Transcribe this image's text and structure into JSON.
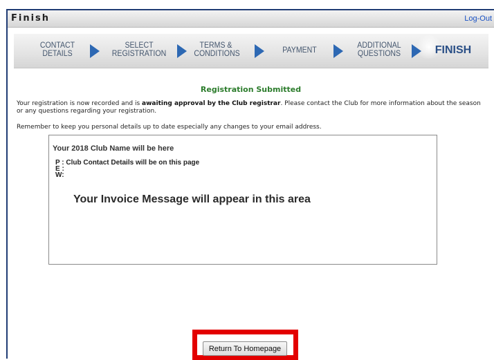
{
  "window": {
    "title": "Finish",
    "logout_label": "Log-Out"
  },
  "steps": [
    {
      "line1": "CONTACT",
      "line2": "DETAILS"
    },
    {
      "line1": "SELECT",
      "line2": "REGISTRATION"
    },
    {
      "line1": "TERMS &",
      "line2": "CONDITIONS"
    },
    {
      "line1": "PAYMENT",
      "line2": ""
    },
    {
      "line1": "ADDITIONAL",
      "line2": "QUESTIONS"
    },
    {
      "line1": "FINISH",
      "line2": ""
    }
  ],
  "active_step": "FINISH",
  "content": {
    "heading": "Registration Submitted",
    "para1_before": "Your registration is now recorded and is ",
    "para1_bold": "awaiting approval by the Club registrar",
    "para1_after": ". Please contact the Club for more information about the season or any questions regarding your registration.",
    "para2": "Remember to keep you personal details up to date especially any changes to your email address."
  },
  "invoice": {
    "club_name": "Your 2018 Club Name will be here",
    "phone_line": "P :  Club Contact Details will be on this page",
    "email_line": "E :",
    "web_line": "W:",
    "message": "Your Invoice Message will appear in this area"
  },
  "buttons": {
    "return_home": "Return To Homepage"
  },
  "colors": {
    "heading": "#2c7c2c",
    "arrow": "#2d68b3",
    "highlight": "#e30000",
    "link": "#1a52c4"
  }
}
